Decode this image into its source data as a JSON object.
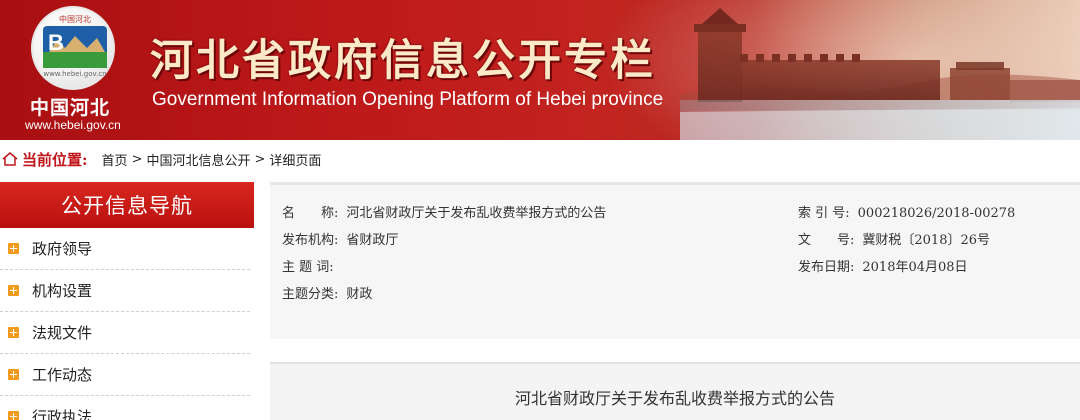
{
  "header": {
    "logo_top_text": "中国河北",
    "logo_bottom_text": "www.hebei.gov.cn",
    "site_name": "中国河北",
    "site_url": "www.hebei.gov.cn",
    "title_cn": "河北省政府信息公开专栏",
    "title_en": "Government Information Opening Platform of Hebei province"
  },
  "breadcrumb": {
    "label": "当前位置:",
    "items": [
      "首页",
      "中国河北信息公开",
      "详细页面"
    ],
    "separator": ">"
  },
  "nav": {
    "title": "公开信息导航",
    "items": [
      "政府领导",
      "机构设置",
      "法规文件",
      "工作动态",
      "行政执法"
    ]
  },
  "meta": {
    "name_label": "名　　称:",
    "name_value": "河北省财政厅关于发布乱收费举报方式的公告",
    "org_label": "发布机构:",
    "org_value": "省财政厅",
    "subject_label": "主 题 词:",
    "subject_value": "",
    "category_label": "主题分类:",
    "category_value": "财政",
    "index_label": "索 引 号:",
    "index_value": "000218026/2018-00278",
    "docno_label": "文　　号:",
    "docno_value": "冀财税〔2018〕26号",
    "date_label": "发布日期:",
    "date_value": "2018年04月08日"
  },
  "document": {
    "title": "河北省财政厅关于发布乱收费举报方式的公告"
  },
  "colors": {
    "banner_red": "#bf1a1a",
    "accent_red": "#c0151a",
    "nav_bullet": "#f29a1c",
    "title_cream": "#fbe9c8"
  }
}
